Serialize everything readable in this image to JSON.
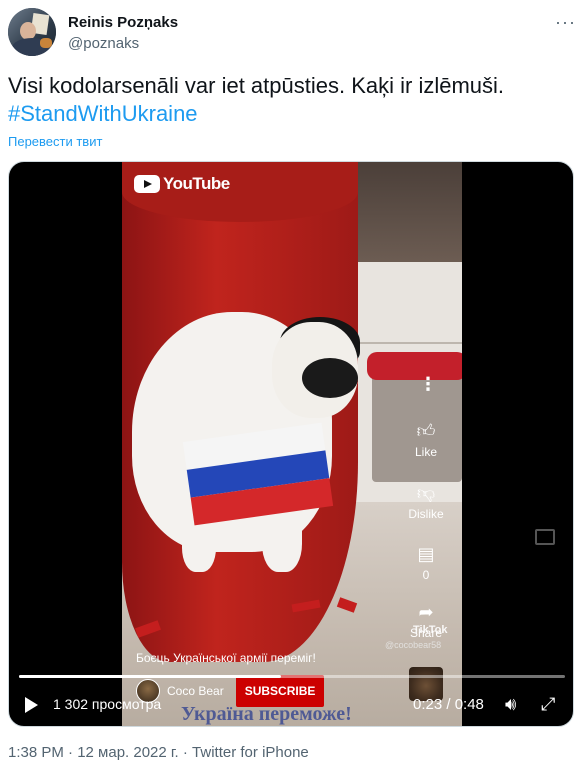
{
  "author": {
    "name": "Reinis Pozņaks",
    "handle": "@poznaks"
  },
  "tweet": {
    "text": "Visi kodolarsenāli var iet atpūsties. Kaķi ir izlēmuši.",
    "hashtag": "#StandWithUkraine",
    "translate_label": "Перевести твит"
  },
  "video": {
    "platform_logo": "YouTube",
    "rail": {
      "like_label": "Like",
      "dislike_label": "Dislike",
      "comments_count": "0",
      "share_label": "Share"
    },
    "tiktok_watermark": "TikTok",
    "tiktok_user": "@cocobear58",
    "caption": "Боєць Української армії переміг!",
    "channel_name": "Coco Bear",
    "subscribe_label": "SUBSCRIBE",
    "overlay_text": "Україна переможе!",
    "views": "1 302 просмотра",
    "time": "0:23 / 0:48",
    "progress": 0.48
  },
  "meta": {
    "timestamp": "1:38 PM · 12 мар. 2022 г. · Twitter for iPhone"
  },
  "colors": {
    "link": "#1d9bf0",
    "subscribe": "#cc0000"
  }
}
